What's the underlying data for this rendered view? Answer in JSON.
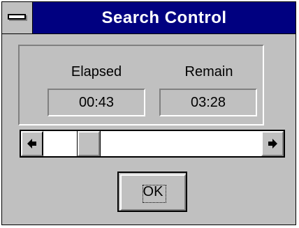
{
  "window": {
    "title": "Search Control"
  },
  "timers": {
    "elapsed_label": "Elapsed",
    "elapsed_value": "00:43",
    "remain_label": "Remain",
    "remain_value": "03:28"
  },
  "progress": {
    "fraction": 0.17
  },
  "scroll_icons": {
    "left": "◆",
    "right": "◆",
    "left_glyph": "←",
    "right_glyph": "→"
  },
  "buttons": {
    "ok_label": "OK"
  },
  "colors": {
    "title_bar": "#000080",
    "face": "#c0c0c0"
  }
}
